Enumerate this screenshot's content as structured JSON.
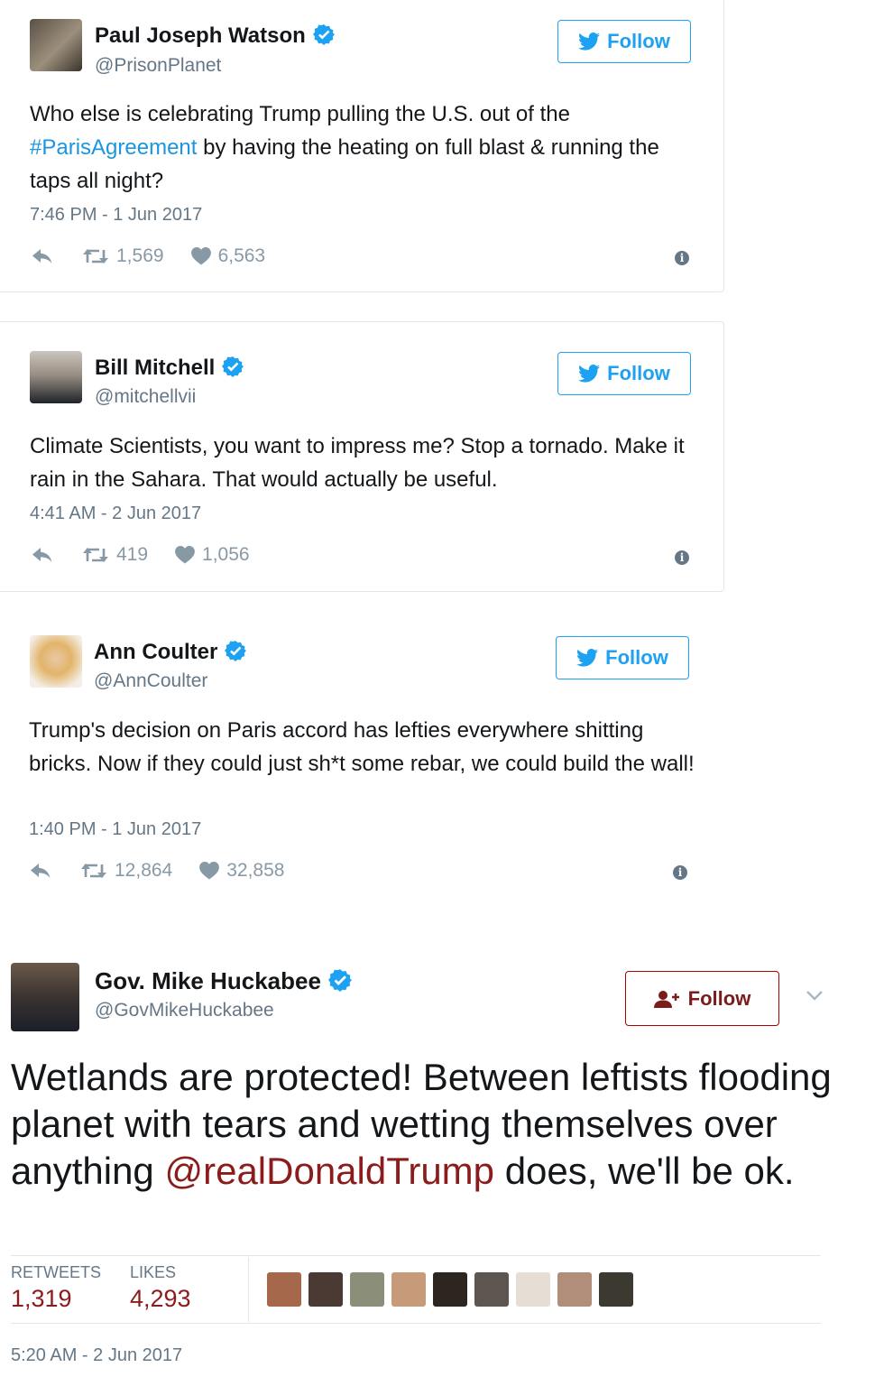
{
  "tweets": [
    {
      "name": "Paul Joseph Watson",
      "handle": "@PrisonPlanet",
      "follow": "Follow",
      "text_pre": "Who else is celebrating Trump pulling the U.S. out of the ",
      "hashtag": "#ParisAgreement",
      "text_post": " by having the heating on full blast & running the taps all night?",
      "time": "7:46 PM - 1 Jun 2017",
      "retweets": "1,569",
      "likes": "6,563"
    },
    {
      "name": "Bill Mitchell",
      "handle": "@mitchellvii",
      "follow": "Follow",
      "text": "Climate Scientists, you want to impress me? Stop a tornado. Make it rain in the Sahara. That would actually be useful.",
      "time": "4:41 AM - 2 Jun 2017",
      "retweets": "419",
      "likes": "1,056"
    },
    {
      "name": "Ann Coulter",
      "handle": "@AnnCoulter",
      "follow": "Follow",
      "text": "Trump's decision on Paris accord has lefties everywhere shitting bricks. Now if they could just sh*t some rebar, we could build the wall!",
      "time": "1:40 PM - 1 Jun 2017",
      "retweets": "12,864",
      "likes": "32,858"
    }
  ],
  "huckabee": {
    "name": "Gov. Mike Huckabee",
    "handle": "@GovMikeHuckabee",
    "follow": "Follow",
    "text_pre": "Wetlands are protected! Between leftists flooding planet with tears and wetting themselves over anything ",
    "mention": "@realDonaldTrump",
    "text_post": " does, we'll be ok.",
    "retweets_label": "RETWEETS",
    "retweets": "1,319",
    "likes_label": "LIKES",
    "likes": "4,293",
    "time": "5:20 AM - 2 Jun 2017"
  },
  "colors": {
    "twitter_blue": "#1da1f2",
    "hashtag": "#1b95e0",
    "muted": "#657786",
    "accent_red": "#8c1c1c"
  },
  "icons": [
    "reply-icon",
    "retweet-icon",
    "heart-icon",
    "info-icon",
    "verified-icon",
    "twitter-bird-icon",
    "follow-user-icon",
    "chevron-down-icon"
  ]
}
